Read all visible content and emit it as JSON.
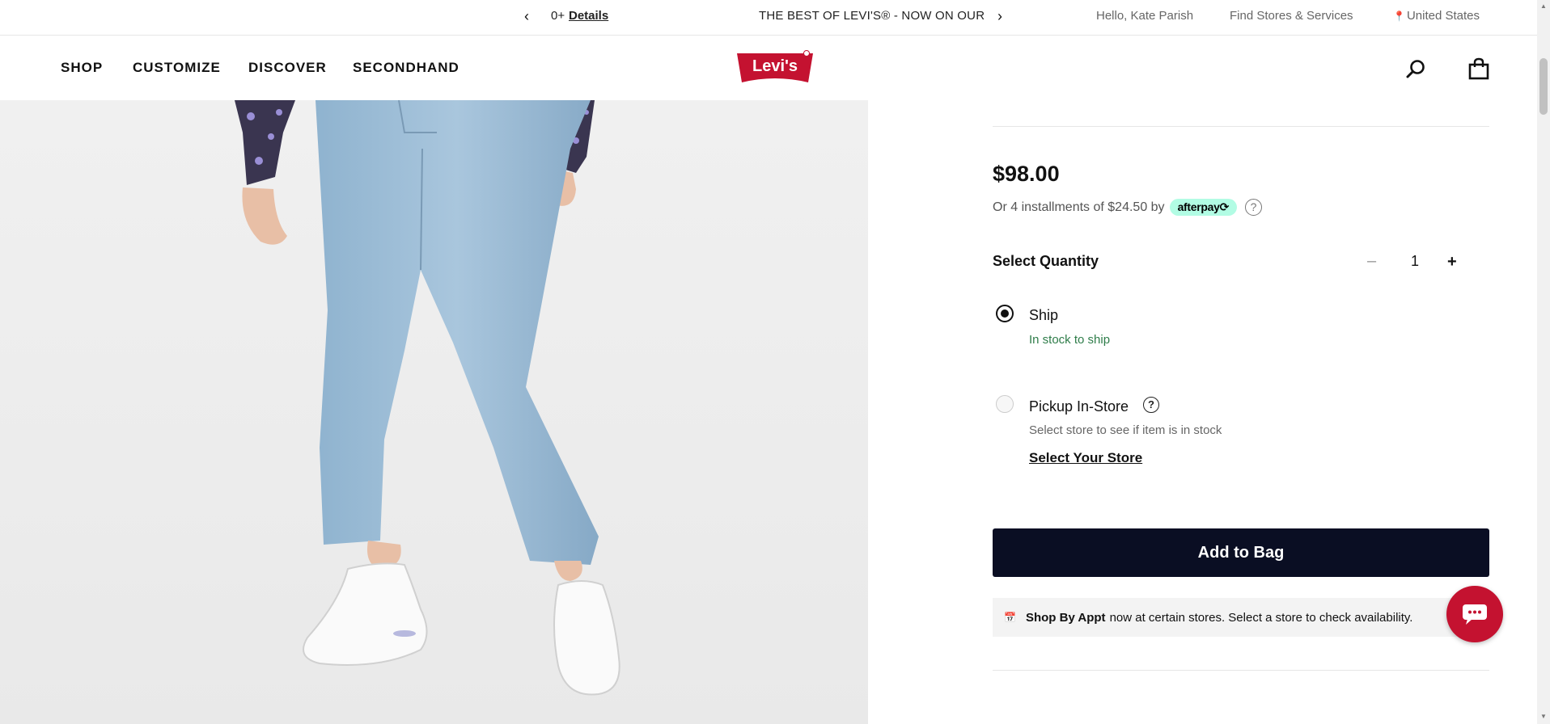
{
  "promo_bar": {
    "prev_label": "‹",
    "next_label": "›",
    "count_text": "0+",
    "details_link": "Details",
    "headline": "THE BEST OF LEVI'S® - NOW ON OUR",
    "greeting": "Hello, Kate Parish",
    "stores_link": "Find Stores & Services",
    "country": "United States"
  },
  "nav": {
    "items": [
      "SHOP",
      "CUSTOMIZE",
      "DISCOVER",
      "SECONDHAND"
    ],
    "logo_text": "Levi's",
    "logo_color": "#c41230"
  },
  "product": {
    "price": "$98.00",
    "installments_text": "Or 4 installments of $24.50 by",
    "afterpay_label": "afterpay⟳",
    "quantity_label": "Select Quantity",
    "quantity_minus": "–",
    "quantity_value": "1",
    "quantity_plus": "+",
    "ship_label": "Ship",
    "ship_status": "In stock to ship",
    "pickup_label": "Pickup In-Store",
    "pickup_help": "?",
    "pickup_note": "Select store to see if item is in stock",
    "select_store_link": "Select Your Store",
    "add_to_bag": "Add to Bag",
    "appt_strong": "Shop By Appt",
    "appt_text": "now at certain stores. Select a store to check availability."
  },
  "colors": {
    "brand_red": "#c41230",
    "button_navy": "#0a0e23",
    "stock_green": "#2f7d4a",
    "afterpay_mint": "#b2fce4"
  }
}
